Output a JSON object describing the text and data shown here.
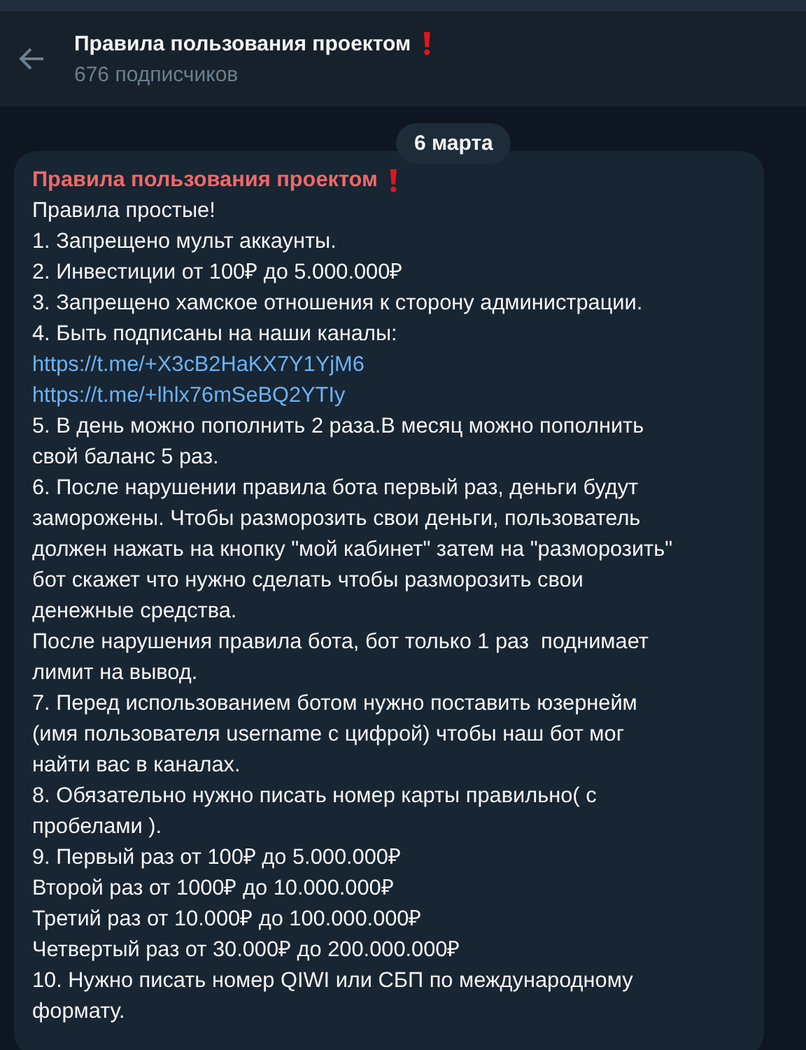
{
  "header": {
    "title": "Правила пользования проектом",
    "subtitle": "676 подписчиков"
  },
  "date_pill": "6 марта",
  "message": {
    "title": "Правила пользования проектом",
    "lines": [
      {
        "kind": "text",
        "text": "Правила простые!"
      },
      {
        "kind": "text",
        "text": "1. Запрещено мульт аккаунты."
      },
      {
        "kind": "text",
        "text": "2. Инвестиции от 100₽ до 5.000.000₽"
      },
      {
        "kind": "text",
        "text": "3. Запрещено хамское отношения к сторону администрации."
      },
      {
        "kind": "text",
        "text": "4. Быть подписаны на наши каналы:"
      },
      {
        "kind": "link",
        "text": "https://t.me/+X3cB2HaKX7Y1YjM6"
      },
      {
        "kind": "link",
        "text": "https://t.me/+lhlx76mSeBQ2YTIy"
      },
      {
        "kind": "text",
        "text": "5. В день можно пополнить 2 раза.В месяц можно пополнить"
      },
      {
        "kind": "text",
        "text": "свой баланс 5 раз."
      },
      {
        "kind": "text",
        "text": "6. После нарушении правила бота первый раз, деньги будут"
      },
      {
        "kind": "text",
        "text": "заморожены. Чтобы разморозить свои деньги, пользователь"
      },
      {
        "kind": "text",
        "text": "должен нажать на кнопку \"мой кабинет\" затем на \"разморозить\""
      },
      {
        "kind": "text",
        "text": "бот скажет что нужно сделать чтобы разморозить свои"
      },
      {
        "kind": "text",
        "text": "денежные средства."
      },
      {
        "kind": "text",
        "text": "После нарушения правила бота, бот только 1 раз  поднимает"
      },
      {
        "kind": "text",
        "text": "лимит на вывод."
      },
      {
        "kind": "text",
        "text": "7. Перед использованием ботом нужно поставить юзернейм"
      },
      {
        "kind": "text",
        "text": "(имя пользователя username с цифрой) чтобы наш бот мог"
      },
      {
        "kind": "text",
        "text": "найти вас в каналах."
      },
      {
        "kind": "text",
        "text": "8. Обязательно нужно писать номер карты правильно( с"
      },
      {
        "kind": "text",
        "text": "пробелами )."
      },
      {
        "kind": "text",
        "text": "9. Первый раз от 100₽ до 5.000.000₽"
      },
      {
        "kind": "text",
        "text": "Второй раз от 1000₽ до 10.000.000₽"
      },
      {
        "kind": "text",
        "text": "Третий раз от 10.000₽ до 100.000.000₽"
      },
      {
        "kind": "text",
        "text": "Четвертый раз от 30.000₽ до 200.000.000₽"
      },
      {
        "kind": "text",
        "text": "10. Нужно писать номер QIWI или СБП по международному"
      },
      {
        "kind": "text",
        "text": "формату."
      }
    ]
  }
}
